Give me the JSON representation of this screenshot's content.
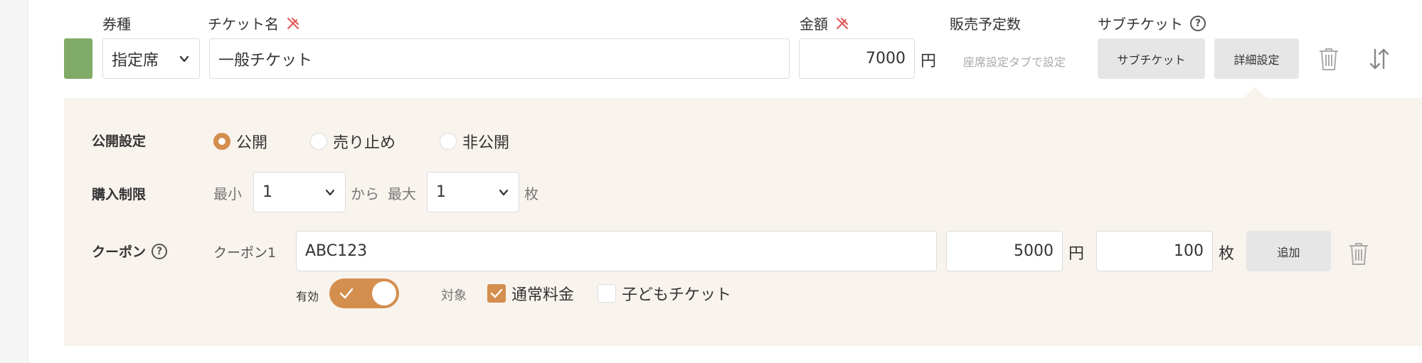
{
  "columns": {
    "type": "券種",
    "ticket_name": "チケット名",
    "price": "金額",
    "planned_sales": "販売予定数",
    "sub_ticket": "サブチケット"
  },
  "row": {
    "color": "#7fab66",
    "type_value": "指定席",
    "ticket_name_value": "一般チケット",
    "price_value": "7000",
    "price_unit": "円",
    "planned_sales_note": "座席設定タブで設定",
    "sub_ticket_button": "サブチケット",
    "detail_button": "詳細設定"
  },
  "detail": {
    "visibility": {
      "label": "公開設定",
      "options": [
        "公開",
        "売り止め",
        "非公開"
      ],
      "selected": "公開"
    },
    "purchase_limit": {
      "label": "購入制限",
      "min_label": "最小",
      "min_value": "1",
      "from_text": "から",
      "max_label": "最大",
      "max_value": "1",
      "unit": "枚"
    },
    "coupon": {
      "label": "クーポン",
      "name": "クーポン1",
      "code": "ABC123",
      "amount": "5000",
      "amount_unit": "円",
      "count": "100",
      "count_unit": "枚",
      "add_button": "追加",
      "enabled_label": "有効",
      "enabled": true,
      "target_label": "対象",
      "targets": [
        {
          "label": "通常料金",
          "checked": true
        },
        {
          "label": "子どもチケット",
          "checked": false
        }
      ]
    }
  },
  "colors": {
    "accent": "#d48e4e",
    "panel_bg": "#f8f3ed",
    "swatch": "#7fab66",
    "required_icon": "#e05656"
  },
  "icons": [
    "required-icon",
    "help-icon",
    "chevron-down-icon",
    "trash-icon",
    "sort-icon",
    "check-icon"
  ]
}
